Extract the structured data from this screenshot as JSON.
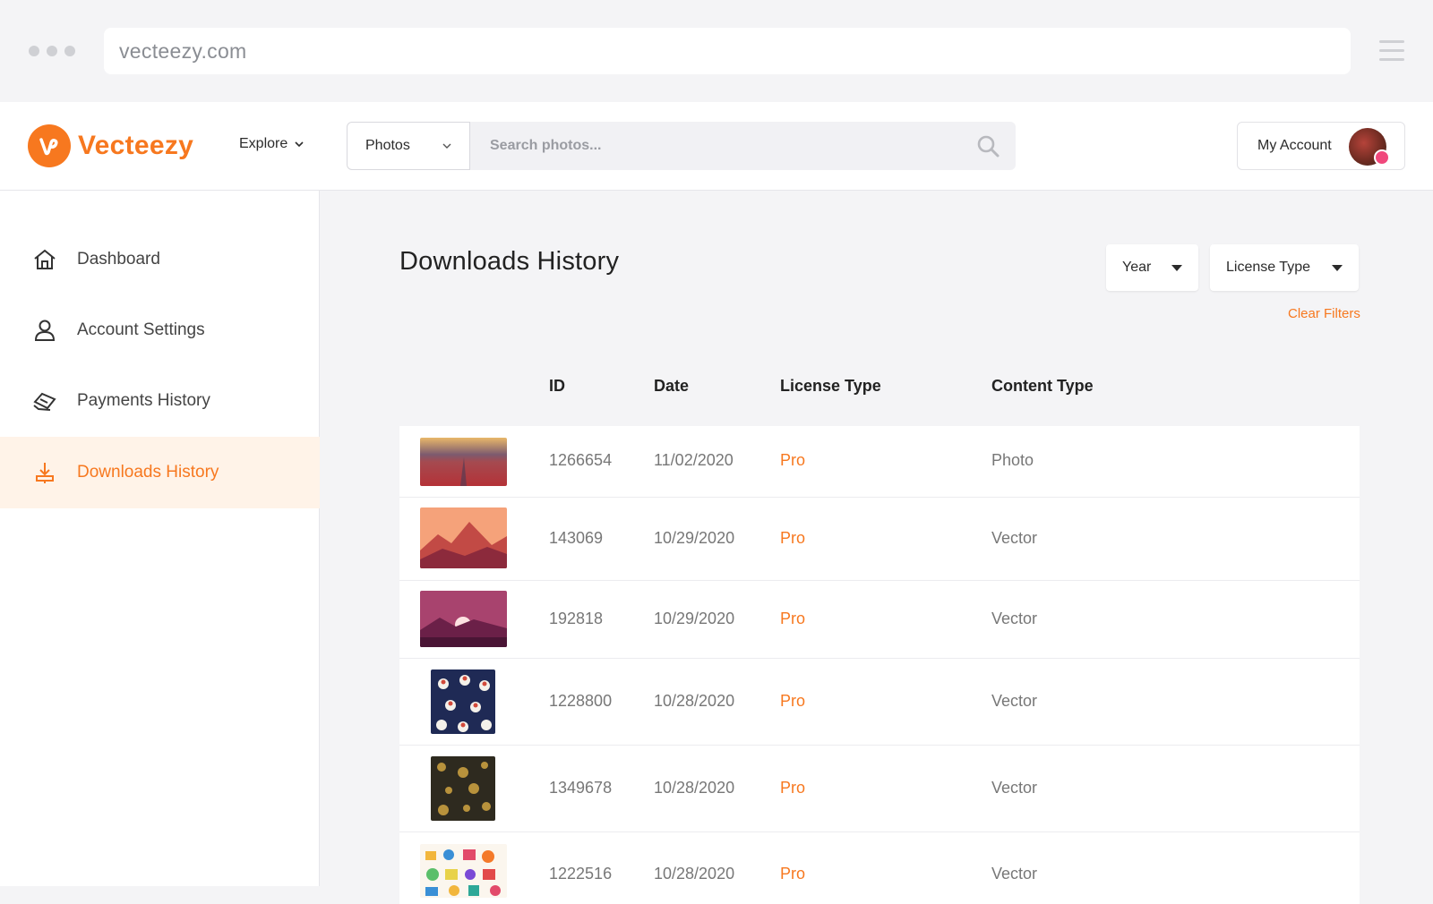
{
  "browser": {
    "url": "vecteezy.com"
  },
  "header": {
    "logo_text": "Vecteezy",
    "explore_label": "Explore",
    "search_category": "Photos",
    "search_placeholder": "Search photos...",
    "account_label": "My Account"
  },
  "sidebar": {
    "items": [
      {
        "label": "Dashboard",
        "icon": "home-icon"
      },
      {
        "label": "Account Settings",
        "icon": "user-icon"
      },
      {
        "label": "Payments History",
        "icon": "payments-icon"
      },
      {
        "label": "Downloads History",
        "icon": "download-icon",
        "active": true
      }
    ]
  },
  "main": {
    "title": "Downloads History",
    "filters": {
      "year_label": "Year",
      "license_label": "License Type",
      "clear_label": "Clear Filters"
    },
    "table": {
      "columns": [
        "ID",
        "Date",
        "License Type",
        "Content Type"
      ],
      "rows": [
        {
          "id": "1266654",
          "date": "11/02/2020",
          "license": "Pro",
          "content": "Photo",
          "thumb": "sunset-field"
        },
        {
          "id": "143069",
          "date": "10/29/2020",
          "license": "Pro",
          "content": "Vector",
          "thumb": "mountain-sunset"
        },
        {
          "id": "192818",
          "date": "10/29/2020",
          "license": "Pro",
          "content": "Vector",
          "thumb": "purple-lake-sunset"
        },
        {
          "id": "1228800",
          "date": "10/28/2020",
          "license": "Pro",
          "content": "Vector",
          "thumb": "navy-flower-pattern"
        },
        {
          "id": "1349678",
          "date": "10/28/2020",
          "license": "Pro",
          "content": "Vector",
          "thumb": "gold-pattern"
        },
        {
          "id": "1222516",
          "date": "10/28/2020",
          "license": "Pro",
          "content": "Vector",
          "thumb": "colorful-doodles"
        }
      ]
    }
  },
  "colors": {
    "accent": "#f7781f",
    "active_bg": "#fff3e8"
  }
}
